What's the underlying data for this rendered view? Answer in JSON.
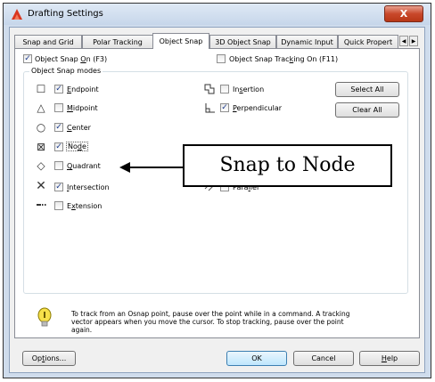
{
  "window": {
    "title": "Drafting Settings",
    "close_label": "X"
  },
  "tabs": [
    {
      "label": "Snap and Grid"
    },
    {
      "label": "Polar Tracking"
    },
    {
      "label": "Object Snap",
      "active": true
    },
    {
      "label": "3D Object Snap"
    },
    {
      "label": "Dynamic Input"
    },
    {
      "label": "Quick Propert"
    }
  ],
  "top_options": {
    "osnap_on": {
      "prefix": "Object Snap ",
      "accel": "O",
      "suffix": "n (F3)",
      "checked": true
    },
    "tracking_on": {
      "prefix": "Object Snap Trac",
      "accel": "k",
      "suffix": "ing On (F11)",
      "checked": false
    }
  },
  "modes_group": {
    "title": "Object Snap modes"
  },
  "modes_left": [
    {
      "accel": "E",
      "rest": "ndpoint",
      "checked": true,
      "symbol": "square-marker-icon"
    },
    {
      "accel": "M",
      "rest": "idpoint",
      "checked": false,
      "symbol": "triangle-marker-icon"
    },
    {
      "accel": "C",
      "rest": "enter",
      "checked": true,
      "symbol": "circle-marker-icon"
    },
    {
      "accel": "",
      "pre": "No",
      "accel2": "d",
      "rest": "e",
      "checked": true,
      "symbol": "node-marker-icon"
    },
    {
      "accel": "Q",
      "rest": "uadrant",
      "checked": false,
      "symbol": "diamond-marker-icon"
    },
    {
      "accel": "I",
      "rest": "ntersection",
      "checked": true,
      "symbol": "x-marker-icon"
    },
    {
      "accel": "",
      "pre": "E",
      "accel2": "x",
      "rest": "tension",
      "checked": false,
      "symbol": "extension-marker-icon"
    }
  ],
  "modes_right": [
    {
      "pre": "In",
      "accel": "s",
      "rest": "ertion",
      "checked": false,
      "symbol": "insertion-marker-icon"
    },
    {
      "pre": "",
      "accel": "P",
      "rest": "erpendicular",
      "checked": true,
      "symbol": "perpendicular-marker-icon"
    },
    {
      "pre": "Para",
      "accel": "l",
      "rest": "lel",
      "checked": false,
      "symbol": "parallel-marker-icon"
    }
  ],
  "buttons": {
    "select_all": "Select All",
    "clear_all": "Clear All",
    "options": "Options...",
    "ok": "OK",
    "cancel": "Cancel",
    "help": "Help"
  },
  "tip": {
    "text": "To track from an Osnap point, pause over the point while in a command.  A tracking vector appears when you move the cursor.  To stop tracking, pause over the point again."
  },
  "callout": {
    "text": "Snap to Node"
  },
  "colors": {
    "title_bg": "#cfdcec",
    "close": "#c9482b",
    "check": "#1b3a8a"
  }
}
